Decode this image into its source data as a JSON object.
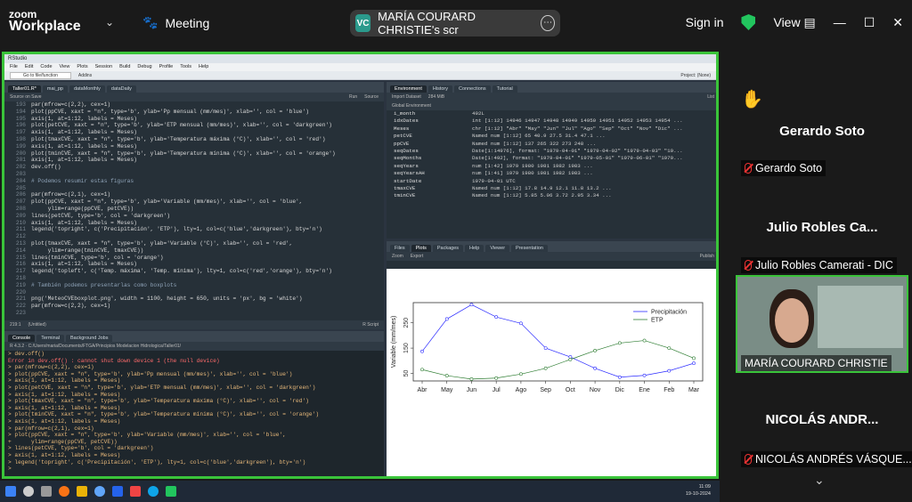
{
  "zoom": {
    "logo_line1": "zoom",
    "logo_line2": "Workplace",
    "meeting": "Meeting",
    "share_initials": "VC",
    "share_title": "MARÍA COURARD CHRISTIE's scr",
    "sign_in": "Sign in",
    "view": "View"
  },
  "rstudio": {
    "title": "RStudio",
    "menu": [
      "File",
      "Edit",
      "Code",
      "View",
      "Plots",
      "Session",
      "Build",
      "Debug",
      "Profile",
      "Tools",
      "Help"
    ],
    "toolbar": [
      "Go to file/function",
      "Addins"
    ],
    "project": "Project: (None)",
    "editor_tabs": [
      "Taller01.R*",
      "mai_pp",
      "dataMonthly",
      "dataDaily"
    ],
    "editor_tools": [
      "Source on Save",
      "Run",
      "Source"
    ],
    "code": [
      [
        "193",
        "par(mfrow=c(2,2), cex=1)"
      ],
      [
        "194",
        "plot(ppCVE, xaxt = \"n\", type='b', ylab='Pp mensual (mm/mes)', xlab='', col = 'blue')"
      ],
      [
        "195",
        "axis(1, at=1:12, labels = Meses)"
      ],
      [
        "196",
        "plot(petCVE, xaxt = \"n\", type='b', ylab='ETP mensual (mm/mes)', xlab='', col = 'darkgreen')"
      ],
      [
        "197",
        "axis(1, at=1:12, labels = Meses)"
      ],
      [
        "198",
        "plot(tmaxCVE, xaxt = \"n\", type='b', ylab='Temperatura máxima (°C)', xlab='', col = 'red')"
      ],
      [
        "199",
        "axis(1, at=1:12, labels = Meses)"
      ],
      [
        "200",
        "plot(tminCVE, xaxt = \"n\", type='b', ylab='Temperatura mínima (°C)', xlab='', col = 'orange')"
      ],
      [
        "201",
        "axis(1, at=1:12, labels = Meses)"
      ],
      [
        "202",
        "dev.off()"
      ],
      [
        "203",
        ""
      ],
      [
        "204",
        "# Podemos resumir estas figuras"
      ],
      [
        "205",
        ""
      ],
      [
        "206",
        "par(mfrow=c(2,1), cex=1)"
      ],
      [
        "207",
        "plot(ppCVE, xaxt = \"n\", type='b', ylab='Variable (mm/mes)', xlab='', col = 'blue',"
      ],
      [
        "208",
        "     ylim=range(ppCVE, petCVE))"
      ],
      [
        "209",
        "lines(petCVE, type='b', col = 'darkgreen')"
      ],
      [
        "210",
        "axis(1, at=1:12, labels = Meses)"
      ],
      [
        "211",
        "legend('topright', c('Precipitación', 'ETP'), lty=1, col=c('blue','darkgreen'), bty='n')"
      ],
      [
        "212",
        ""
      ],
      [
        "213",
        "plot(tmaxCVE, xaxt = \"n\", type='b', ylab='Variable (°C)', xlab='', col = 'red',"
      ],
      [
        "214",
        "     ylim=range(tminCVE, tmaxCVE))"
      ],
      [
        "215",
        "lines(tminCVE, type='b', col = 'orange')"
      ],
      [
        "216",
        "axis(1, at=1:12, labels = Meses)"
      ],
      [
        "217",
        "legend('topleft', c('Temp. máxima', 'Temp. mínima'), lty=1, col=c('red','orange'), bty='n')"
      ],
      [
        "218",
        ""
      ],
      [
        "219",
        "# También podemos presentarlas como boxplots"
      ],
      [
        "220",
        ""
      ],
      [
        "221",
        "png('MeteoCVEboxplot.png', width = 1100, height = 650, units = 'px', bg = 'white')"
      ],
      [
        "222",
        "par(mfrow=c(2,2), cex=1)"
      ],
      [
        "223",
        ""
      ]
    ],
    "editor_status": [
      "219:1",
      "(Untitled)",
      "R Script"
    ],
    "console_tabs": [
      "Console",
      "Terminal",
      "Background Jobs"
    ],
    "console_path": "R 4.3.2 · C:/Users/maria/Documents/FTGA/Principios Modelacion Hidrologica/Taller01/",
    "console": [
      "> dev.off()",
      "Error in dev.off() : cannot shut down device 1 (the null device)",
      "> par(mfrow=c(2,2), cex=1)",
      "> plot(ppCVE, xaxt = \"n\", type='b', ylab='Pp mensual (mm/mes)', xlab='', col = 'blue')",
      "> axis(1, at=1:12, labels = Meses)",
      "> plot(petCVE, xaxt = \"n\", type='b', ylab='ETP mensual (mm/mes)', xlab='', col = 'darkgreen')",
      "> axis(1, at=1:12, labels = Meses)",
      "> plot(tmaxCVE, xaxt = \"n\", type='b', ylab='Temperatura máxima (°C)', xlab='', col = 'red')",
      "> axis(1, at=1:12, labels = Meses)",
      "> plot(tminCVE, xaxt = \"n\", type='b', ylab='Temperatura mínima (°C)', xlab='', col = 'orange')",
      "> axis(1, at=1:12, labels = Meses)",
      "> par(mfrow=c(2,1), cex=1)",
      "> plot(ppCVE, xaxt = \"n\", type='b', ylab='Variable (mm/mes)', xlab='', col = 'blue',",
      "+      ylim=range(ppCVE, petCVE))",
      "> lines(petCVE, type='b', col = 'darkgreen')",
      "> axis(1, at=1:12, labels = Meses)",
      "> legend('topright', c('Precipitación', 'ETP'), lty=1, col=c('blue','darkgreen'), bty='n')",
      ">"
    ],
    "env_tabs": [
      "Environment",
      "History",
      "Connections",
      "Tutorial"
    ],
    "env_tools": [
      "Import Dataset",
      "284 MiB",
      "Global Environment",
      "List"
    ],
    "env_rows": [
      [
        "i_month",
        "492L"
      ],
      [
        "idxDates",
        "int [1:12] 14946 14947 14948 14949 14950 14951 14952 14953 14954 ..."
      ],
      [
        "Meses",
        "chr [1:12] \"Abr\" \"May\" \"Jun\" \"Jul\" \"Ago\" \"Sep\" \"Oct\" \"Nov\" \"Dic\" ..."
      ],
      [
        "petCVE",
        "Named num [1:12] 65 40.9 27.5 31.4 47.1 ..."
      ],
      [
        "ppCVE",
        "Named num [1:12] 137 265 322 273 248 ..."
      ],
      [
        "seqDates",
        "Date[1:14976], format: \"1979-04-01\" \"1979-04-02\" \"1979-04-03\" \"19..."
      ],
      [
        "seqMonths",
        "Date[1:492], format: \"1979-04-01\" \"1979-05-01\" \"1979-06-01\" \"1979..."
      ],
      [
        "seqYears",
        "num [1:42] 1979 1980 1981 1982 1983 ..."
      ],
      [
        "seqYearsAH",
        "num [1:41] 1979 1980 1981 1982 1983 ..."
      ],
      [
        "startDate",
        "1979-04-01 UTC"
      ],
      [
        "tmaxCVE",
        "Named num [1:12] 17.8 14.9 12.1 11.8 13.2 ..."
      ],
      [
        "tminCVE",
        "Named num [1:12] 5.85 5.06 3.72 2.95 3.34 ..."
      ]
    ],
    "plot_tabs": [
      "Files",
      "Plots",
      "Packages",
      "Help",
      "Viewer",
      "Presentation"
    ],
    "plot_tools": [
      "Zoom",
      "Export",
      "Publish"
    ]
  },
  "chart_data": {
    "type": "line",
    "categories": [
      "Abr",
      "May",
      "Jun",
      "Jul",
      "Ago",
      "Sep",
      "Oct",
      "Nov",
      "Dic",
      "Ene",
      "Feb",
      "Mar"
    ],
    "series": [
      {
        "name": "Precipitación",
        "color": "#2a2aff",
        "values": [
          137,
          265,
          322,
          273,
          248,
          150,
          115,
          70,
          35,
          42,
          60,
          90
        ]
      },
      {
        "name": "ETP",
        "color": "#2e7d32",
        "values": [
          65,
          40.9,
          27.5,
          31.4,
          47.1,
          70,
          105,
          140,
          170,
          180,
          150,
          110
        ]
      }
    ],
    "ylabel": "Variable (mm/mes)",
    "yticks": [
      50,
      150,
      250
    ],
    "ylim": [
      20,
      330
    ],
    "legend": "top-right"
  },
  "taskbar": {
    "time": "11:09",
    "date": "19-10-2024"
  },
  "participants": [
    {
      "big": "Gerardo Soto",
      "label": "Gerardo Soto",
      "hand": "✋"
    },
    {
      "big": "Julio Robles Ca...",
      "label": "Julio Robles Camerati - DIC"
    },
    {
      "label": "MARÍA COURARD CHRISTIE"
    },
    {
      "big": "NICOLÁS ANDR...",
      "label": "NICOLÁS ANDRÉS VÁSQUE..."
    }
  ]
}
